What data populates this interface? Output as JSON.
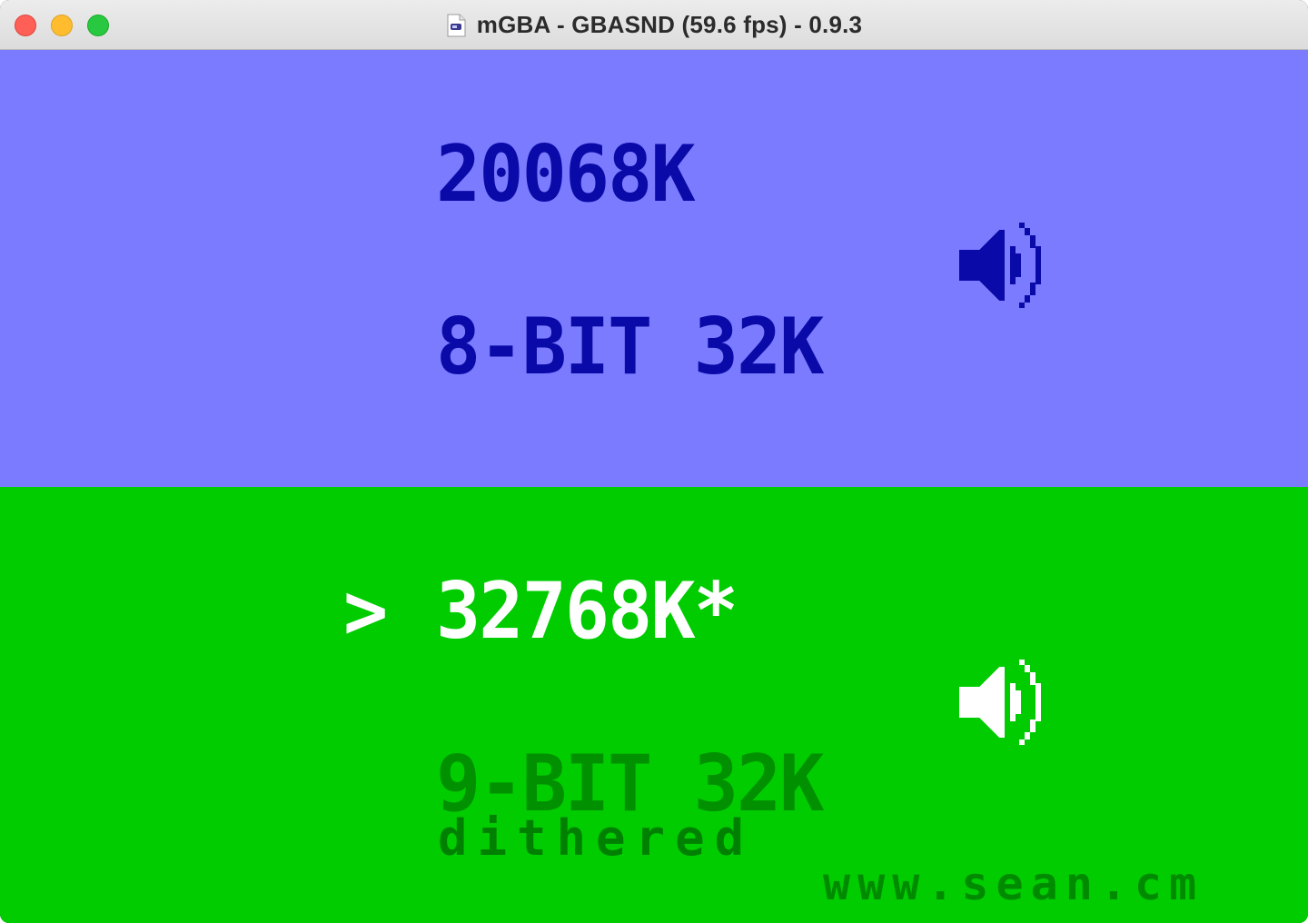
{
  "window": {
    "title": "mGBA - GBASND (59.6 fps) - 0.9.3",
    "buttons": [
      "close",
      "minimize",
      "maximize"
    ]
  },
  "screen": {
    "top_panel": {
      "background": "#7b7bff",
      "text_color": "#0a0aa8",
      "rate": "20068K",
      "format": "8-BIT 32K",
      "icon": "speaker-icon"
    },
    "bottom_panel": {
      "background": "#00cc00",
      "selector": ">",
      "rate": "32768K*",
      "format": "9-BIT 32K",
      "note": "dithered",
      "icon": "speaker-icon",
      "url": "www.sean.cm"
    }
  },
  "colors": {
    "traffic_close": "#fe5f57",
    "traffic_minimize": "#febc2e",
    "traffic_maximize": "#28c840"
  }
}
